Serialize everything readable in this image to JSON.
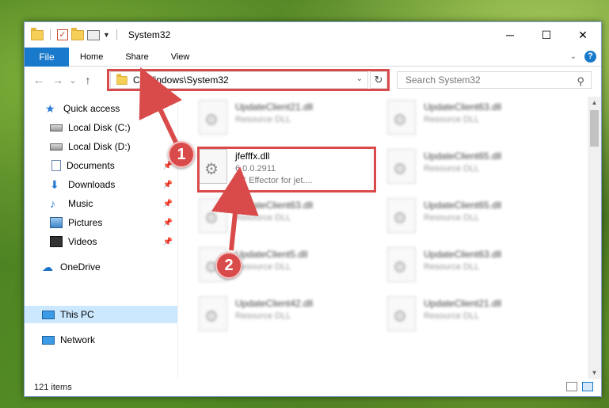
{
  "window": {
    "title": "System32",
    "controls": {
      "minimize": "─",
      "maximize": "☐",
      "close": "✕"
    }
  },
  "ribbon": {
    "file_tab": "File",
    "tabs": [
      "Home",
      "Share",
      "View"
    ]
  },
  "navigation": {
    "back": "←",
    "forward": "→",
    "recent": "⌄",
    "up": "↑",
    "address": "C:\\Windows\\System32",
    "refresh": "↻",
    "search_placeholder": "Search System32"
  },
  "sidebar": {
    "items": [
      {
        "label": "Quick access",
        "icon": "star-icon",
        "pinned": false
      },
      {
        "label": "Local Disk (C:)",
        "icon": "drive-icon",
        "pinned": false
      },
      {
        "label": "Local Disk (D:)",
        "icon": "drive-icon",
        "pinned": false
      },
      {
        "label": "Documents",
        "icon": "documents-icon",
        "pinned": true
      },
      {
        "label": "Downloads",
        "icon": "downloads-icon",
        "pinned": true
      },
      {
        "label": "Music",
        "icon": "music-icon",
        "pinned": true
      },
      {
        "label": "Pictures",
        "icon": "pictures-icon",
        "pinned": true
      },
      {
        "label": "Videos",
        "icon": "videos-icon",
        "pinned": true
      },
      {
        "label": "OneDrive",
        "icon": "onedrive-icon",
        "pinned": false
      },
      {
        "label": "This PC",
        "icon": "this-pc-icon",
        "pinned": false,
        "selected": true
      },
      {
        "label": "Network",
        "icon": "network-icon",
        "pinned": false
      }
    ]
  },
  "files": {
    "highlighted": {
      "name": "jfefffx.dll",
      "version": "6.0.0.2911",
      "description": "FX Effector for jet...."
    },
    "blurred": [
      {
        "name": "UpdateClient21.dll",
        "type": "Resource DLL"
      },
      {
        "name": "UpdateClient63.dll",
        "type": "Resource DLL"
      },
      {
        "name": "UpdateClient65.dll",
        "type": "Resource DLL"
      },
      {
        "name": "UpdateClient63.dll",
        "type": "Resource DLL"
      },
      {
        "name": "UpdateClient65.dll",
        "type": "Resource DLL"
      },
      {
        "name": "UpdateClient5.dll",
        "type": "Resource DLL"
      },
      {
        "name": "UpdateClient63.dll",
        "type": "Resource DLL"
      },
      {
        "name": "UpdateClient42.dll",
        "type": "Resource DLL"
      },
      {
        "name": "UpdateClient21.dll",
        "type": "Resource DLL"
      }
    ]
  },
  "status": {
    "item_count": "121 items"
  },
  "annotations": {
    "step1": "1",
    "step2": "2",
    "highlight_color": "#d94b4b"
  }
}
